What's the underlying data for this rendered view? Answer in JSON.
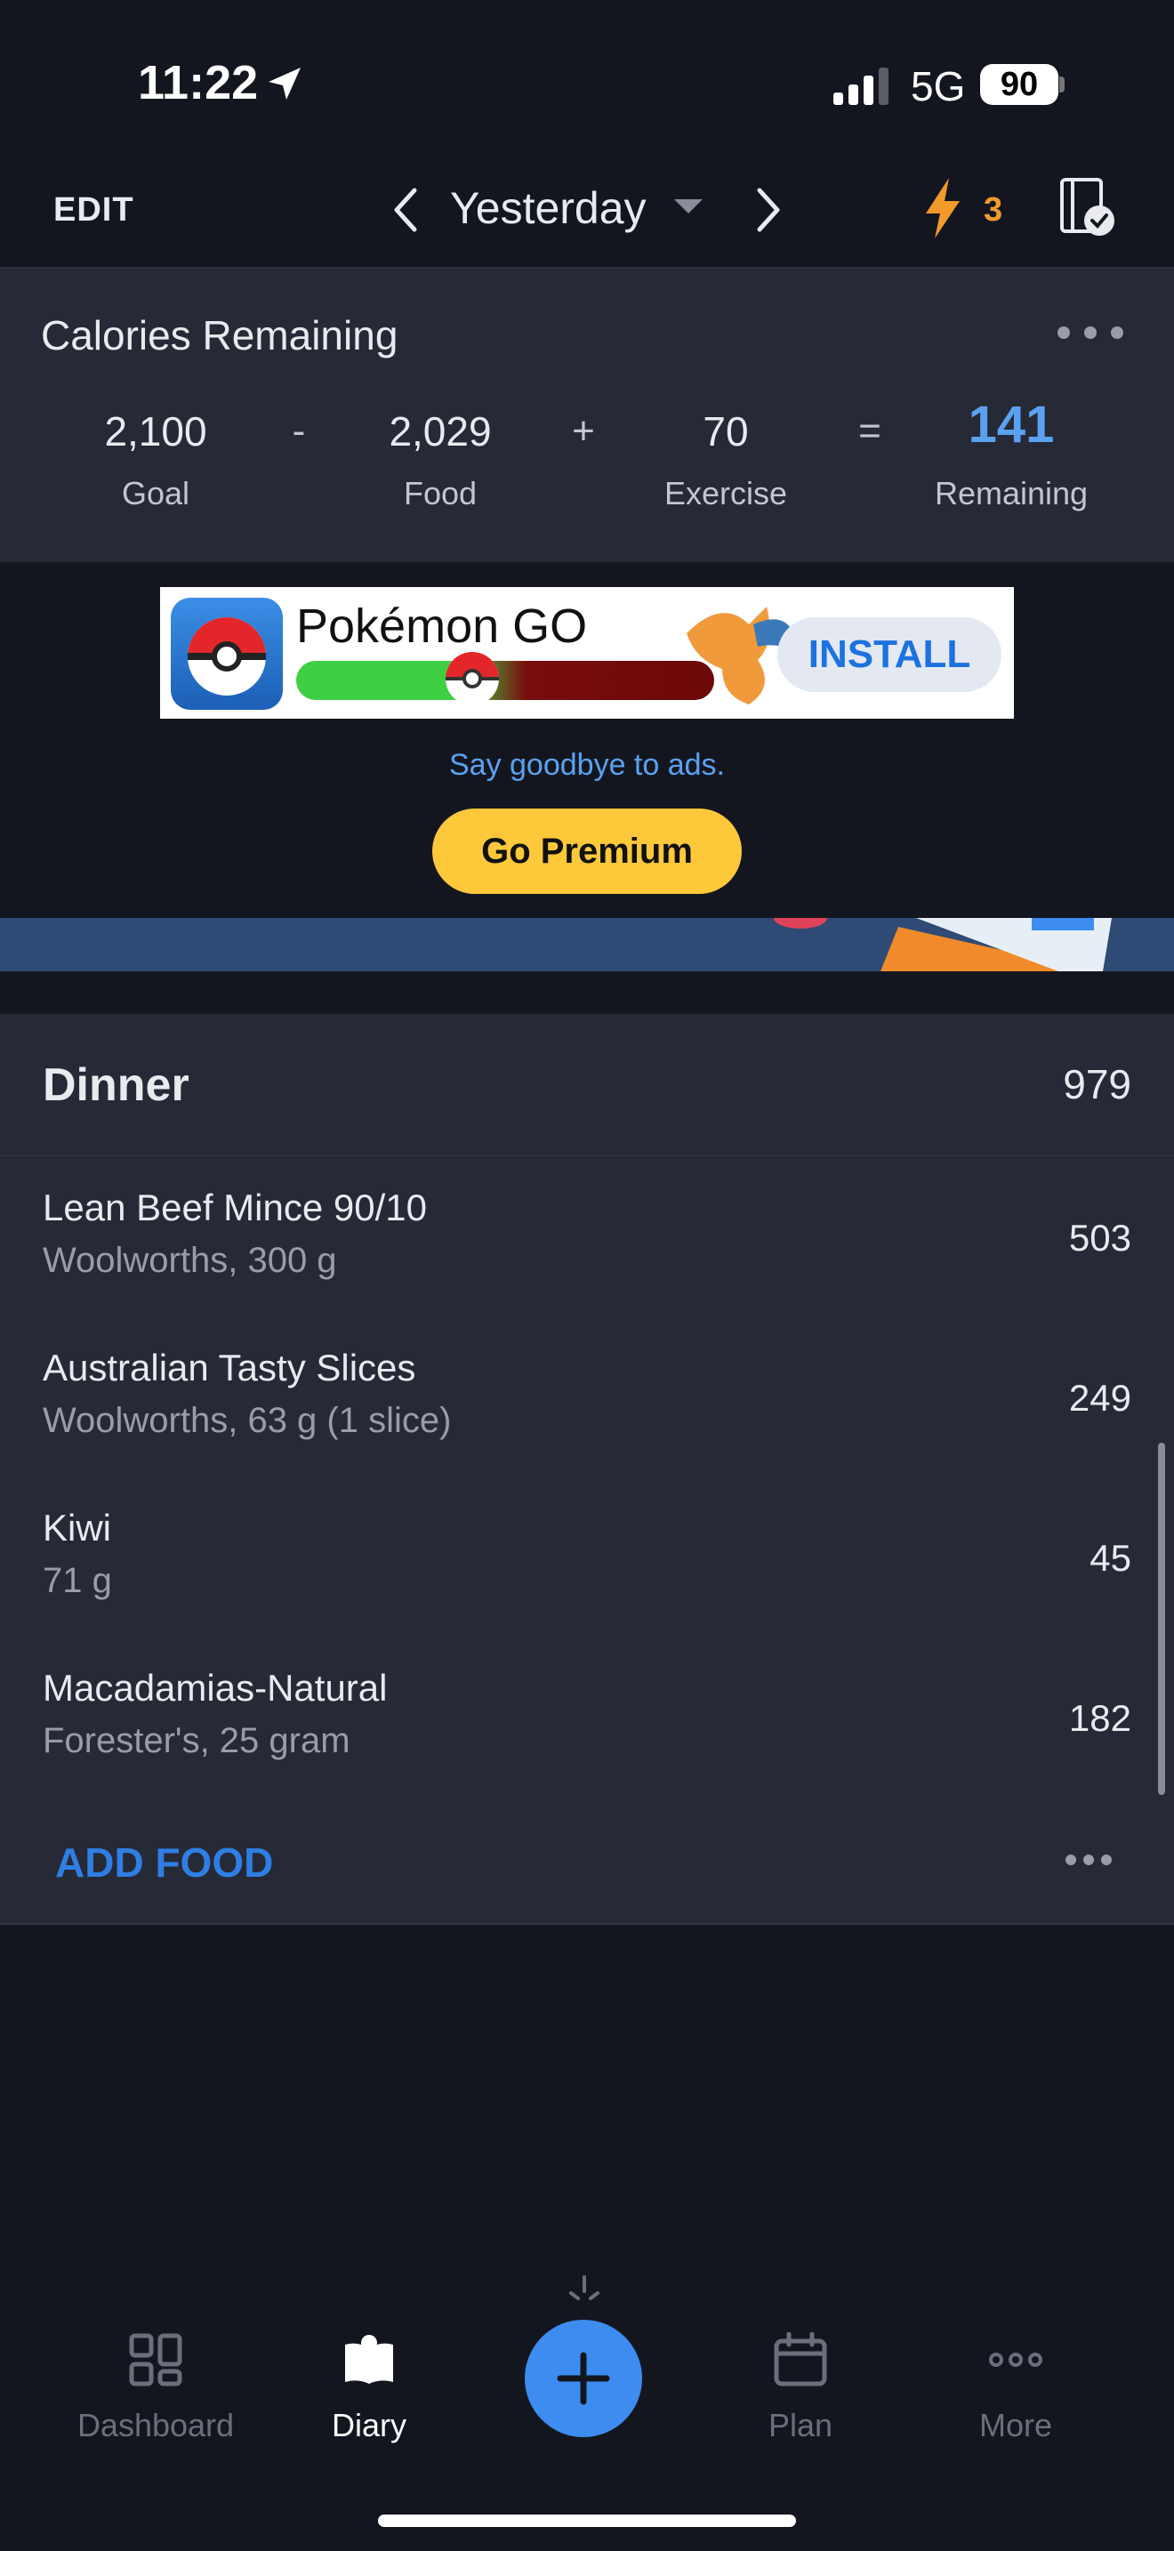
{
  "status_bar": {
    "time": "11:22",
    "network": "5G",
    "battery": "90"
  },
  "nav": {
    "edit": "EDIT",
    "date": "Yesterday",
    "streak": "3"
  },
  "calories": {
    "title": "Calories Remaining",
    "goal": "2,100",
    "goal_label": "Goal",
    "minus": "-",
    "food": "2,029",
    "food_label": "Food",
    "plus": "+",
    "exercise": "70",
    "exercise_label": "Exercise",
    "equals": "=",
    "remaining": "141",
    "remaining_label": "Remaining"
  },
  "ad": {
    "title": "Pokémon GO",
    "install": "INSTALL",
    "tagline": "Say goodbye to ads.",
    "premium": "Go Premium"
  },
  "dinner": {
    "title": "Dinner",
    "total": "979",
    "items": [
      {
        "name": "Lean Beef Mince 90/10",
        "detail": "Woolworths, 300 g",
        "calories": "503"
      },
      {
        "name": "Australian Tasty Slices",
        "detail": "Woolworths, 63 g (1 slice)",
        "calories": "249"
      },
      {
        "name": "Kiwi",
        "detail": "71 g",
        "calories": "45"
      },
      {
        "name": "Macadamias-Natural",
        "detail": "Forester's, 25 gram",
        "calories": "182"
      }
    ],
    "add_food": "ADD FOOD"
  },
  "tabbar": {
    "dashboard": "Dashboard",
    "diary": "Diary",
    "plan": "Plan",
    "more": "More"
  },
  "colors": {
    "accent": "#3d8df0",
    "remaining": "#5aa2f0",
    "premium": "#fdc83a",
    "streak": "#f29b2a"
  }
}
